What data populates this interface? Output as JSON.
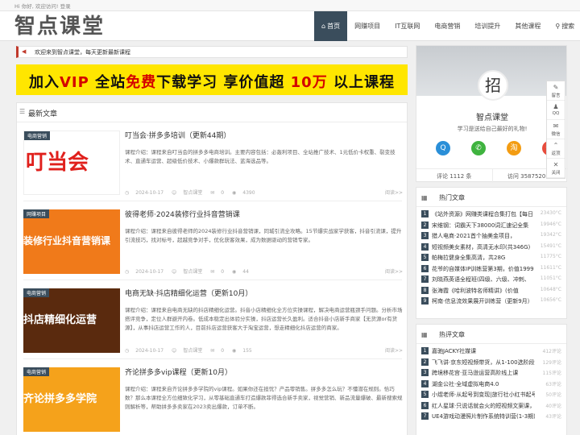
{
  "topbar": {
    "login_text": "Hi 你好, 欢迎访问! 登录"
  },
  "header": {
    "logo": "智点课堂"
  },
  "nav": [
    {
      "label": "首页",
      "icon": "home-icon",
      "active": true
    },
    {
      "label": "网赚项目"
    },
    {
      "label": "IT互联网"
    },
    {
      "label": "电商营销"
    },
    {
      "label": "培训提升"
    },
    {
      "label": "其他课程"
    },
    {
      "label": "搜索",
      "icon": "search-icon"
    }
  ],
  "notice": {
    "text": "欢迎来到智点课堂，每天更新最新课程"
  },
  "banner": {
    "text_a": "加入",
    "text_vip": "VIP",
    "text_b": " 全站",
    "text_free": "免费",
    "text_c": "下载学习 享价值超 ",
    "text_num": "10万",
    "text_d": " 以上课程"
  },
  "latest": {
    "title": "最新文章",
    "articles": [
      {
        "category": "电商营销",
        "thumb_text": "叮当会",
        "title": "叮当会·拼多多培训（更新44期）",
        "desc": "课程介绍：课程来自叮当会的拼多多电商培训。主要内容包括：必轰利项目、全站推广技术、1元低价卡权重、裂变技术、直通车运营、超级低价技术、小爆款群玩法、蓝海选品等。",
        "date": "2024-10-17",
        "author": "智点课堂",
        "comments": "0",
        "views": "4390",
        "more": "阅读>>"
      },
      {
        "category": "网赚项目",
        "thumb_text": "装修行业抖音营销课",
        "title": "彼得老师·2024装修行业抖音营销课",
        "desc": "课程介绍：课程来自彼得老师的2024装修行业抖音营销课，同城引流全攻略。15节爆实战家学获客，抖音引流课，提升引流技巧，找对标号，超越竞争对手，优化获客效果，成为数据驱动的营销专家。",
        "date": "2024-10-17",
        "author": "智点课堂",
        "comments": "0",
        "views": "44",
        "more": "阅读>>"
      },
      {
        "category": "电商营销",
        "thumb_text": "抖店精细化运营",
        "title": "电商无缺·抖店精细化运营（更新10月）",
        "desc": "课程介绍：课程来自电商无缺的抖店精细化运营。抖音小店精细化全方位实操课程，解决电商运营瓶颈手问题。分析市场搭评竞争，定位人群避开内卷。低成本稳定出体验分实操，抖店运营长久盈利。适合抖音小店新手商家【无货源or有货源】，从事抖店运营工作的人，目前抖店运营获客大于淘宝运营，想走精细化抖店运营的商家。",
        "date": "2024-10-17",
        "author": "智点课堂",
        "comments": "0",
        "views": "155",
        "more": "阅读>>"
      },
      {
        "category": "电商营销",
        "thumb_text": "齐论拼多多学院",
        "title": "齐论拼多多vip课程（更新10月）",
        "desc": "课程介绍：课程来自齐论拼多多学院的vip课程。如果你还在担忧？产品零销售。拼多多怎么玩？不懂潜在规则。恰巧数？那么本课程全方位细致化学习，从零基础直通车打造爆款菲得选合新手卖家，视觉营销、新品流量爆破、最新搜索规则解析等，帮助拼多多卖家在2023卖出爆款，订单不断。",
        "date": "",
        "author": "",
        "comments": "",
        "views": "",
        "more": ""
      }
    ]
  },
  "profile": {
    "avatar_text": "招",
    "name": "智点课堂",
    "motto": "学习是送给自己最好的礼物!",
    "socials": [
      {
        "icon": "qq-icon",
        "glyph": "Q",
        "color": "#2a8fd8"
      },
      {
        "icon": "wechat-icon",
        "glyph": "✆",
        "color": "#3fb33f"
      },
      {
        "icon": "taobao-icon",
        "glyph": "淘",
        "color": "#f39c12"
      },
      {
        "icon": "weibo-icon",
        "glyph": "微",
        "color": "#e74c3c"
      }
    ],
    "comments": "评论 1112 条",
    "visits": "访问 3587520 次"
  },
  "hot": {
    "title": "热门文章",
    "items": [
      {
        "num": "1",
        "text": "《站外资源》网赚类课程合集打包【每日",
        "date": "23430°C"
      },
      {
        "num": "2",
        "text": "宋维钢：词霸天下38000词汇速记全集",
        "date": "19946°C"
      },
      {
        "num": "3",
        "text": "猎人电商·2021首个抽美金项目，",
        "date": "19342°C"
      },
      {
        "num": "4",
        "text": "短视频美女素材，高清无水印(共346G)",
        "date": "15491°C"
      },
      {
        "num": "5",
        "text": "帕梅拉健身全集高清，共28G",
        "date": "11775°C"
      },
      {
        "num": "6",
        "text": "花爷的自媒体IP训练营第3期，价值1999",
        "date": "11611°C"
      },
      {
        "num": "7",
        "text": "刘晓燕英语全程班(四级、六级、冲刺、",
        "date": "11051°C"
      },
      {
        "num": "8",
        "text": "张海霞《哈利波特名师精讲》(价值",
        "date": "10648°C"
      },
      {
        "num": "9",
        "text": "柯南·信息流效果展开训练营（更新9月）",
        "date": "10656°C"
      }
    ]
  },
  "comment_widget": {
    "title": "热评文章",
    "items": [
      {
        "num": "1",
        "text": "嘉驰JACKY社媒课",
        "date": "412评论"
      },
      {
        "num": "2",
        "text": "飞飞讲·京东短视频带货，从1-100选阶段",
        "date": "129评论"
      },
      {
        "num": "3",
        "text": "跨境移花宫·亚马逊运营高阶线上课",
        "date": "115评论"
      },
      {
        "num": "4",
        "text": "湖金公社·全域虚拟电商4.0",
        "date": "63评论"
      },
      {
        "num": "5",
        "text": "小煜老师·从起号到变现|旅行社小红书起号",
        "date": "50评论"
      },
      {
        "num": "6",
        "text": "红人星球·只说话就会火的短视频文案课，价",
        "date": "40评论"
      },
      {
        "num": "7",
        "text": "UE4游戏动漫照片制作系统特训营(1-3期),",
        "date": "43评论"
      }
    ]
  },
  "float_bar": [
    {
      "icon": "message-icon",
      "glyph": "✎",
      "label": "留言"
    },
    {
      "icon": "qq-icon",
      "glyph": "♟",
      "label": "QQ"
    },
    {
      "icon": "wechat-icon",
      "glyph": "✉",
      "label": "微信"
    },
    {
      "icon": "top-icon",
      "glyph": "⌃",
      "label": "返顶"
    },
    {
      "icon": "close-icon",
      "glyph": "✕",
      "label": "关闭"
    }
  ]
}
